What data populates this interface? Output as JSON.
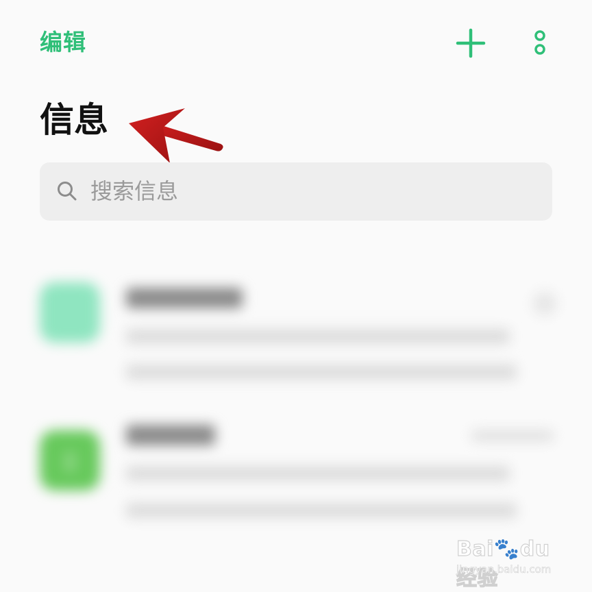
{
  "header": {
    "edit_label": "编辑",
    "plus_icon": "plus-icon",
    "more_icon": "more-vertical-icon"
  },
  "title": "信息",
  "search": {
    "placeholder": "搜索信息",
    "icon": "search-icon"
  },
  "annotation": {
    "type": "red-arrow",
    "color": "#b71c1c",
    "points_to": "page-title"
  },
  "colors": {
    "accent": "#2fbf78",
    "background": "#fafafa",
    "search_bg": "#eeeeee",
    "arrow": "#b71c1c",
    "avatar_1": "#8fe5c0",
    "avatar_2": "#67c95c"
  },
  "conversations": [
    {
      "blurred": true,
      "avatar_color": "#8fe5c0"
    },
    {
      "blurred": true,
      "avatar_color": "#67c95c"
    }
  ],
  "watermark": {
    "brand": "Bai",
    "brand_rest": "du",
    "suffix": "经验",
    "url": "jingyan.baidu.com"
  }
}
